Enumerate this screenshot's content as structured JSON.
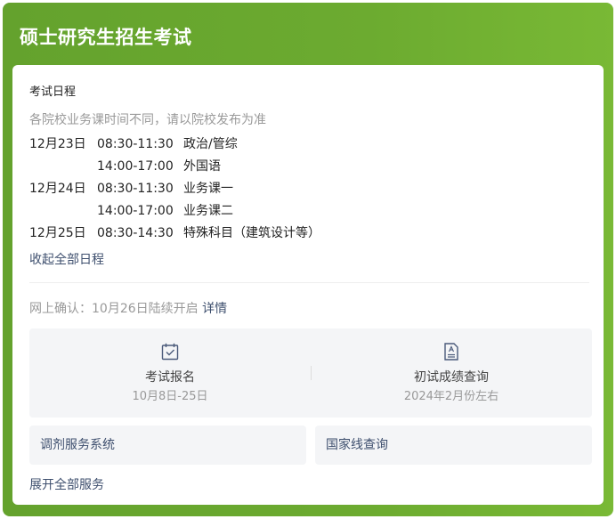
{
  "header": {
    "title": "硕士研究生招生考试"
  },
  "schedule": {
    "section_title": "考试日程",
    "notice": "各院校业务课时间不同，请以院校发布为准",
    "rows": [
      {
        "date": "12月23日",
        "time": "08:30-11:30",
        "subject": "政治/管综"
      },
      {
        "date": "",
        "time": "14:00-17:00",
        "subject": "外国语"
      },
      {
        "date": "12月24日",
        "time": "08:30-11:30",
        "subject": "业务课一"
      },
      {
        "date": "",
        "time": "14:00-17:00",
        "subject": "业务课二"
      },
      {
        "date": "12月25日",
        "time": "08:30-14:30",
        "subject": "特殊科目（建筑设计等）"
      }
    ],
    "collapse_label": "收起全部日程"
  },
  "confirm": {
    "text": "网上确认：10月26日陆续开启",
    "detail_label": "详情"
  },
  "services": {
    "items": [
      {
        "label": "考试报名",
        "sub": "10月8日-25日",
        "icon": "calendar-check-icon"
      },
      {
        "label": "初试成绩查询",
        "sub": "2024年2月份左右",
        "icon": "document-icon"
      }
    ],
    "buttons": [
      {
        "label": "调剂服务系统"
      },
      {
        "label": "国家线查询"
      }
    ],
    "expand_label": "展开全部服务"
  },
  "colors": {
    "header_green": "#6cab30",
    "link": "#3e4f6e",
    "muted": "#999999",
    "icon": "#4a5a7a"
  }
}
